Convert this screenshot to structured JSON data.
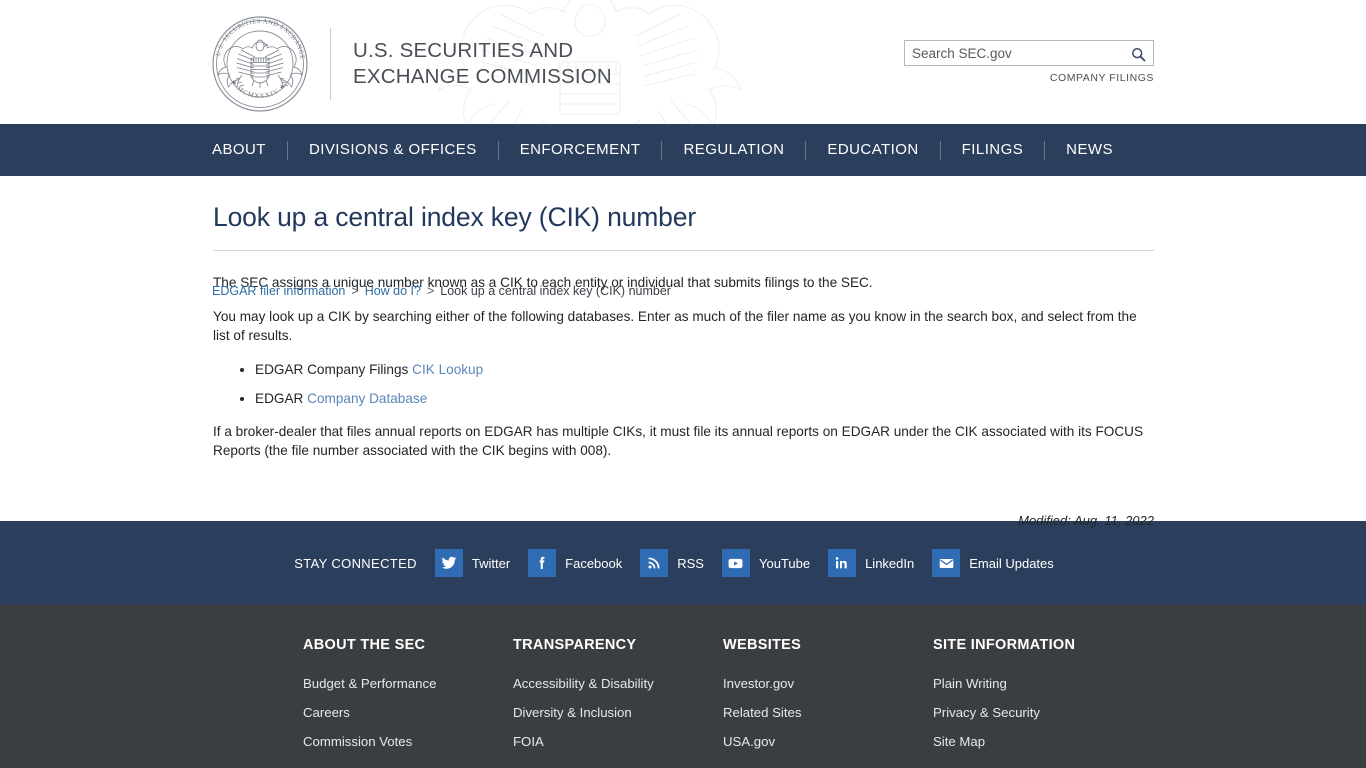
{
  "header": {
    "logo_alt": "U.S. Securities and Exchange Commission seal",
    "agency_line1": "U.S. SECURITIES AND",
    "agency_line2": "EXCHANGE COMMISSION",
    "seal_text_top": "U.S. SECURITIES AND EXCHANGE COMMISSION",
    "seal_year": "MCMXXXIV",
    "search": {
      "placeholder": "Search SEC.gov",
      "value": "",
      "button_icon": "search-icon"
    },
    "company_filings_label": "COMPANY FILINGS"
  },
  "nav": {
    "items": [
      {
        "label": "ABOUT"
      },
      {
        "label": "DIVISIONS & OFFICES"
      },
      {
        "label": "ENFORCEMENT"
      },
      {
        "label": "REGULATION"
      },
      {
        "label": "EDUCATION"
      },
      {
        "label": "FILINGS"
      },
      {
        "label": "NEWS"
      }
    ]
  },
  "breadcrumb": {
    "items": [
      {
        "label": "EDGAR filer information",
        "is_link": true
      },
      {
        "label": "How do I?",
        "is_link": true
      },
      {
        "label": "Look up a central index key (CIK) number",
        "is_link": false
      }
    ],
    "separator": ">"
  },
  "main": {
    "title": "Look up a central index key (CIK) number",
    "paragraph1": "The SEC assigns a unique number known as a CIK to each entity or individual that submits filings to the SEC.",
    "paragraph2": "You may look up a CIK by searching either of the following databases. Enter as much of the filer name as you know in the search box, and select from the list of results.",
    "bullets": [
      {
        "text": "EDGAR Company Filings ",
        "link_text": "CIK Lookup",
        "link_first": false
      },
      {
        "text": "EDGAR ",
        "link_text": "Company Database",
        "link_first": false
      }
    ],
    "paragraph3": "If a broker-dealer that files annual reports on EDGAR has multiple CIKs, it must file its annual reports on EDGAR under the CIK associated with its FOCUS Reports (the file number associated with the CIK begins with 008).",
    "modified": "Modified: Aug. 11, 2022"
  },
  "social": {
    "stay_connected_label": "STAY CONNECTED",
    "items": [
      {
        "label": "Twitter",
        "icon": "twitter-icon"
      },
      {
        "label": "Facebook",
        "icon": "facebook-icon"
      },
      {
        "label": "RSS",
        "icon": "rss-icon"
      },
      {
        "label": "YouTube",
        "icon": "youtube-icon"
      },
      {
        "label": "LinkedIn",
        "icon": "linkedin-icon"
      },
      {
        "label": "Email Updates",
        "icon": "envelope-icon"
      }
    ]
  },
  "footer": {
    "columns": [
      {
        "heading": "ABOUT THE SEC",
        "links": [
          "Budget & Performance",
          "Careers",
          "Commission Votes"
        ]
      },
      {
        "heading": "TRANSPARENCY",
        "links": [
          "Accessibility & Disability",
          "Diversity & Inclusion",
          "FOIA"
        ]
      },
      {
        "heading": "WEBSITES",
        "links": [
          "Investor.gov",
          "Related Sites",
          "USA.gov"
        ]
      },
      {
        "heading": "SITE INFORMATION",
        "links": [
          "Plain Writing",
          "Privacy & Security",
          "Site Map"
        ]
      }
    ]
  },
  "colors": {
    "nav_navy": "#2b3f5c",
    "footer_gray": "#3b3e40",
    "title_navy": "#23395d",
    "link_blue": "#5b87b8",
    "social_icon_blue": "#2f6cb3"
  }
}
